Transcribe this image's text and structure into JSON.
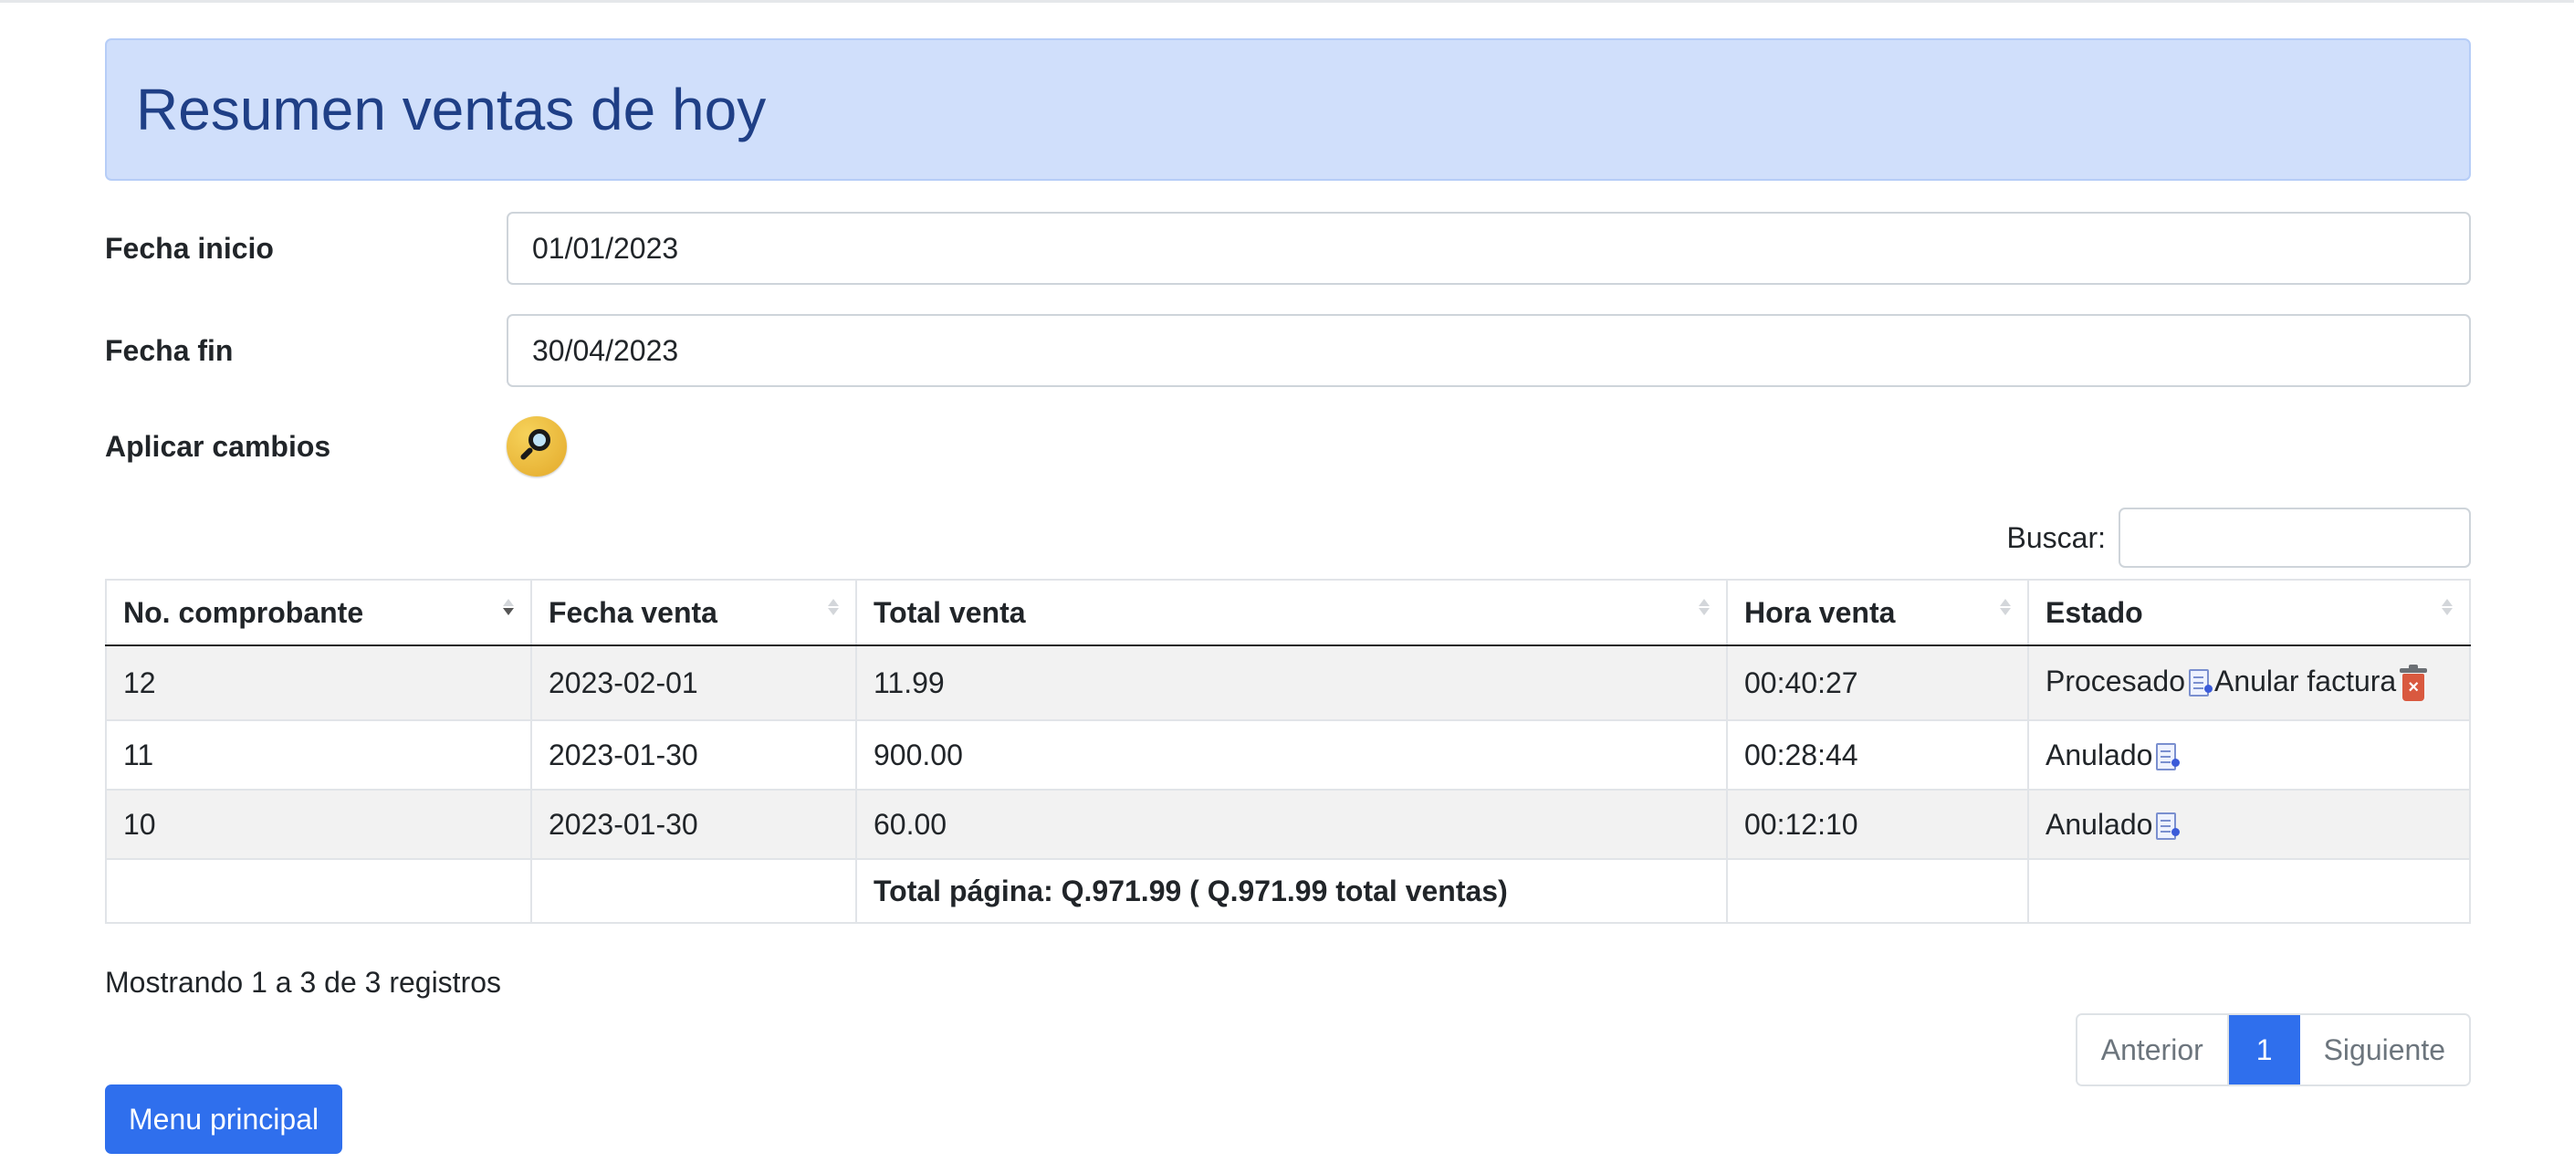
{
  "header": {
    "title": "Resumen ventas de hoy"
  },
  "form": {
    "start_label": "Fecha inicio",
    "start_value": "01/01/2023",
    "end_label": "Fecha fin",
    "end_value": "30/04/2023",
    "apply_label": "Aplicar cambios"
  },
  "search": {
    "label": "Buscar:",
    "value": ""
  },
  "table": {
    "columns": [
      "No. comprobante",
      "Fecha venta",
      "Total venta",
      "Hora venta",
      "Estado"
    ],
    "rows": [
      {
        "no": "12",
        "fecha": "2023-02-01",
        "total": "11.99",
        "hora": "00:40:27",
        "estado": "Procesado",
        "action": "Anular factura"
      },
      {
        "no": "11",
        "fecha": "2023-01-30",
        "total": "900.00",
        "hora": "00:28:44",
        "estado": "Anulado"
      },
      {
        "no": "10",
        "fecha": "2023-01-30",
        "total": "60.00",
        "hora": "00:12:10",
        "estado": "Anulado"
      }
    ],
    "footer_total": "Total página: Q.971.99 ( Q.971.99 total ventas)"
  },
  "info": "Mostrando 1 a 3 de 3 registros",
  "pagination": {
    "prev": "Anterior",
    "current": "1",
    "next": "Siguiente"
  },
  "menu_button": "Menu principal",
  "icons": {
    "apply": "magnifier-icon",
    "document": "document-icon",
    "trash": "trash-icon"
  },
  "colors": {
    "accent": "#2f6fed",
    "header_bg": "#d0dffb",
    "header_text": "#1f3f86"
  }
}
